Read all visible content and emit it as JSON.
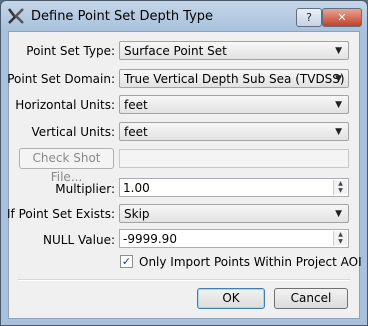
{
  "window": {
    "title": "Define Point Set Depth Type",
    "help_label": "?",
    "close_label": "✕"
  },
  "form": {
    "point_set_type": {
      "label": "Point Set Type:",
      "value": "Surface Point Set"
    },
    "point_set_domain": {
      "label": "Point Set Domain:",
      "value": "True Vertical Depth Sub Sea (TVDSS)"
    },
    "horizontal_units": {
      "label": "Horizontal Units:",
      "value": "feet"
    },
    "vertical_units": {
      "label": "Vertical Units:",
      "value": "feet"
    },
    "check_shot": {
      "button_label": "Check Shot File...",
      "value": ""
    },
    "multiplier": {
      "label": "Multiplier:",
      "value": "1.00"
    },
    "if_exists": {
      "label": "If Point Set Exists:",
      "value": "Skip"
    },
    "null_value": {
      "label": "NULL Value:",
      "value": "-9999.90"
    },
    "import_aoi": {
      "label": "Only Import Points Within Project AOI",
      "checked": true
    }
  },
  "buttons": {
    "ok": "OK",
    "cancel": "Cancel"
  },
  "icons": {
    "app": "app-logo-icon",
    "dropdown": "chevron-down-icon",
    "spin_up": "spin-up-icon",
    "spin_down": "spin-down-icon"
  }
}
